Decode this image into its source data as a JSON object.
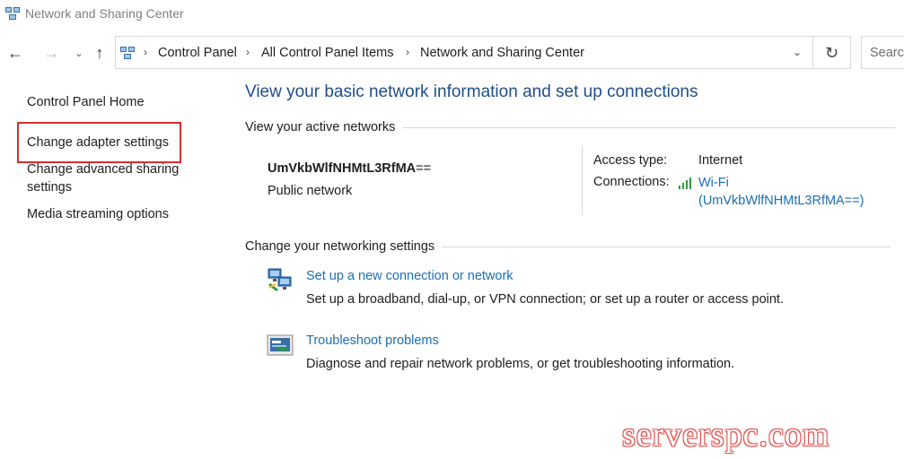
{
  "window": {
    "title": "Network and Sharing Center",
    "icon": "network-sharing-icon"
  },
  "nav": {
    "back_icon": "arrow-left-icon",
    "forward_icon": "arrow-right-icon",
    "recent_icon": "chevron-down-icon",
    "up_icon": "arrow-up-icon",
    "breadcrumbs": [
      "Control Panel",
      "All Control Panel Items",
      "Network and Sharing Center"
    ],
    "refresh_icon": "refresh-icon",
    "search_placeholder": "Search Control Panel"
  },
  "sidebar": {
    "items": [
      {
        "label": "Control Panel Home"
      },
      {
        "label": "Change adapter settings",
        "highlighted": true
      },
      {
        "label": "Change advanced sharing settings"
      },
      {
        "label": "Media streaming options"
      }
    ],
    "highlight_color": "#d32f2f"
  },
  "main": {
    "title": "View your basic network information and set up connections",
    "active_networks_heading": "View your active networks",
    "network": {
      "name": "UmVkbWlfNHMtL3RfMA",
      "name_suffix": "==",
      "type": "Public network",
      "access_type_label": "Access type:",
      "access_type_value": "Internet",
      "connections_label": "Connections:",
      "connection_link_line1": "Wi-Fi",
      "connection_link_line2": "(UmVkbWlfNHMtL3RfMA==)"
    },
    "change_settings_heading": "Change your networking settings",
    "tasks": [
      {
        "link": "Set up a new connection or network",
        "description": "Set up a broadband, dial-up, or VPN connection; or set up a router or access point.",
        "icon": "new-connection-icon"
      },
      {
        "link": "Troubleshoot problems",
        "description": "Diagnose and repair network problems, or get troubleshooting information.",
        "icon": "troubleshoot-icon"
      }
    ]
  },
  "watermark": "serverspc.com",
  "colors": {
    "title_blue": "#1f4e8c",
    "link_blue": "#1a6fb5",
    "wifi_green": "#2e9b3a"
  }
}
